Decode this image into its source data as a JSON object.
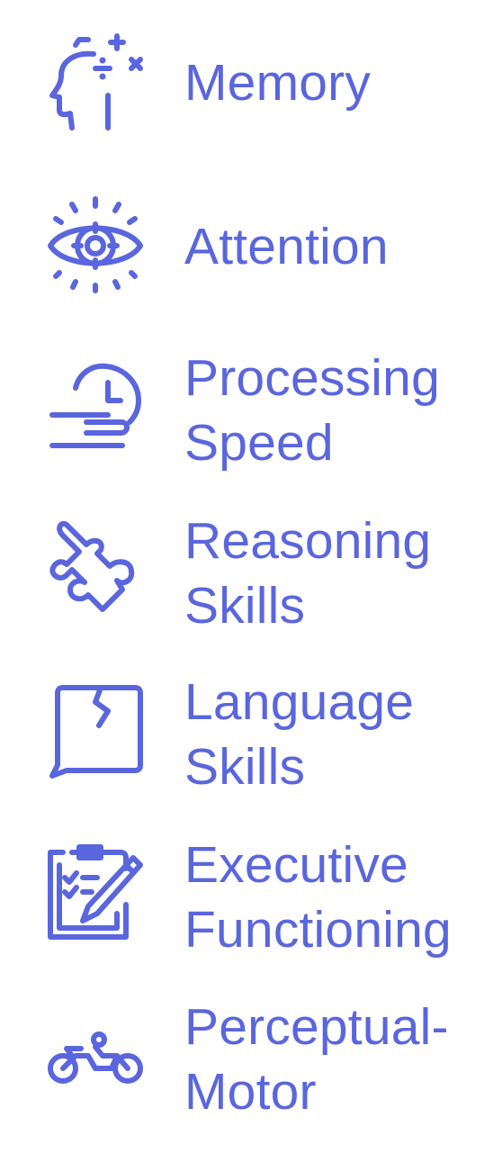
{
  "accent_color": "#5a66dd",
  "items": [
    {
      "label": "Memory",
      "icon": "head-math-icon"
    },
    {
      "label": "Attention",
      "icon": "eye-target-icon"
    },
    {
      "label": "Processing\nSpeed",
      "icon": "clock-speed-icon"
    },
    {
      "label": "Reasoning\nSkills",
      "icon": "puzzle-piece-icon"
    },
    {
      "label": "Language\nSkills",
      "icon": "broken-speech-bubble-icon"
    },
    {
      "label": "Executive\nFunctioning",
      "icon": "clipboard-pencil-icon"
    },
    {
      "label": "Perceptual-\nMotor",
      "icon": "bicycle-rider-icon"
    }
  ]
}
